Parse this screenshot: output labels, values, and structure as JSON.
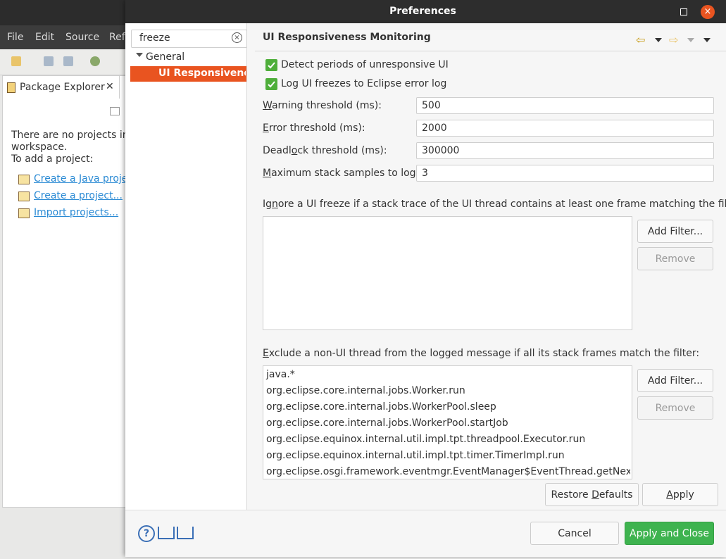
{
  "background": {
    "menu": [
      "File",
      "Edit",
      "Source",
      "Ref"
    ],
    "package_explorer": {
      "tab_label": "Package Explorer",
      "message_line1": "There are no projects in y",
      "message_line2": "workspace.",
      "message_line3": "To add a project:",
      "links": [
        "Create a Java projec",
        "Create a project...",
        "Import projects..."
      ]
    }
  },
  "dialog": {
    "title": "Preferences",
    "close_glyph": "×",
    "filter": {
      "value": "freeze",
      "clear_glyph": "×"
    },
    "tree": {
      "group": "General",
      "selected": "UI Responsiveness Monitoring"
    },
    "page": {
      "title": "UI Responsiveness Monitoring",
      "nav_back": "⇦",
      "nav_forward": "⇨"
    },
    "checkboxes": [
      {
        "label": "Detect periods of unresponsive UI",
        "checked": true
      },
      {
        "label": "Log UI freezes to Eclipse error log",
        "checked": true
      }
    ],
    "fields": [
      {
        "label_pre": "",
        "label_u": "W",
        "label_post": "arning threshold (ms):",
        "value": "500"
      },
      {
        "label_pre": "",
        "label_u": "E",
        "label_post": "rror threshold (ms):",
        "value": "2000"
      },
      {
        "label_pre": "Deadl",
        "label_u": "o",
        "label_post": "ck threshold (ms):",
        "value": "300000"
      },
      {
        "label_pre": "",
        "label_u": "M",
        "label_post": "aximum stack samples to log:",
        "value": "3"
      }
    ],
    "ignore_section": {
      "label_pre": "Ig",
      "label_u": "n",
      "label_post": "ore a UI freeze if a stack trace of the UI thread contains at least one frame matching the filter:",
      "entries": [],
      "add_button": "Add Filter...",
      "remove_button": "Remove"
    },
    "exclude_section": {
      "label_pre": "",
      "label_u": "E",
      "label_post": "xclude a non-UI thread from the logged message if all its stack frames match the filter:",
      "entries": [
        "java.*",
        "org.eclipse.core.internal.jobs.Worker.run",
        "org.eclipse.core.internal.jobs.WorkerPool.sleep",
        "org.eclipse.core.internal.jobs.WorkerPool.startJob",
        "org.eclipse.equinox.internal.util.impl.tpt.threadpool.Executor.run",
        "org.eclipse.equinox.internal.util.impl.tpt.timer.TimerImpl.run",
        "org.eclipse.osgi.framework.eventmgr.EventManager$EventThread.getNextEvent"
      ],
      "add_button": "Add Filter...",
      "remove_button": "Remove"
    },
    "restore_defaults": {
      "pre": "Restore ",
      "u": "D",
      "post": "efaults"
    },
    "apply": {
      "pre": "",
      "u": "A",
      "post": "pply"
    },
    "cancel": "Cancel",
    "apply_and_close": "Apply and Close",
    "help_glyph": "?",
    "colors": {
      "accent": "#e95420",
      "primary_button": "#3eb34f",
      "checkbox": "#4eae3a"
    }
  }
}
